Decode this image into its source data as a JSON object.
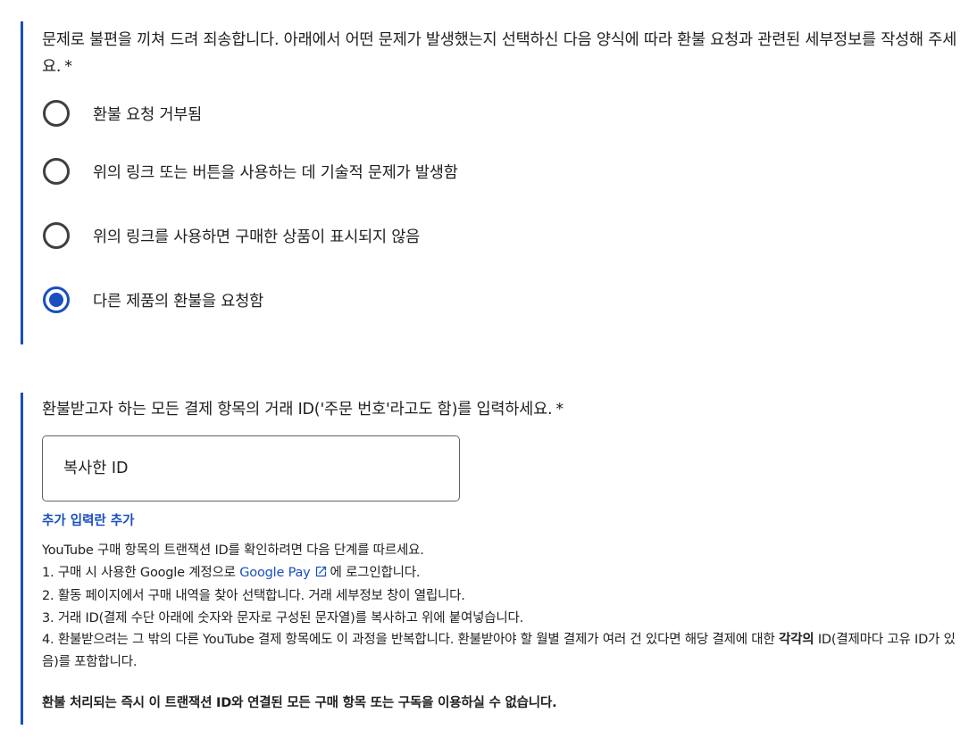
{
  "section1": {
    "question": "문제로 불편을 끼쳐 드려 죄송합니다. 아래에서 어떤 문제가 발생했는지 선택하신 다음 양식에 따라 환불 요청과 관련된 세부정보를 작성해 주세요.",
    "required_mark": "*",
    "options": [
      {
        "label": "환불 요청 거부됨",
        "checked": false
      },
      {
        "label": "위의 링크 또는 버튼을 사용하는 데 기술적 문제가 발생함",
        "checked": false
      },
      {
        "label": "위의 링크를 사용하면 구매한 상품이 표시되지 않음",
        "checked": false
      },
      {
        "label": "다른 제품의 환불을 요청함",
        "checked": true
      }
    ]
  },
  "section2": {
    "question": "환불받고자 하는 모든 결제 항목의 거래 ID('주문 번호'라고도 함)를 입력하세요.",
    "required_mark": "*",
    "input_placeholder": "복사한 ID",
    "input_value": "",
    "add_field_label": "추가 입력란 추가",
    "help_intro": "YouTube 구매 항목의 트랜잭션 ID를 확인하려면 다음 단계를 따르세요.",
    "step1_before": "1. 구매 시 사용한 Google 계정으로",
    "step1_link": "Google Pay",
    "step1_after": "에 로그인합니다.",
    "step2": "2. 활동 페이지에서 구매 내역을 찾아 선택합니다. 거래 세부정보 창이 열립니다.",
    "step3": "3. 거래 ID(결제 수단 아래에 숫자와 문자로 구성된 문자열)를 복사하고 위에 붙여넣습니다.",
    "step4_before": "4. 환불받으려는 그 밖의 다른 YouTube 결제 항목에도 이 과정을 반복합니다. 환불받아야 할 월별 결제가 여러 건 있다면 해당 결제에 대한",
    "step4_bold": "각각의",
    "step4_after": "ID(결제마다 고유 ID가 있음)를 포함합니다.",
    "notice": "환불 처리되는 즉시 이 트랜잭션 ID와 연결된 모든 구매 항목 또는 구독을 이용하실 수 없습니다."
  },
  "icons": {
    "external_link": "external-link-icon"
  },
  "colors": {
    "accent": "#1a4ec0",
    "text": "#202124",
    "radio_border": "#3c4043"
  }
}
